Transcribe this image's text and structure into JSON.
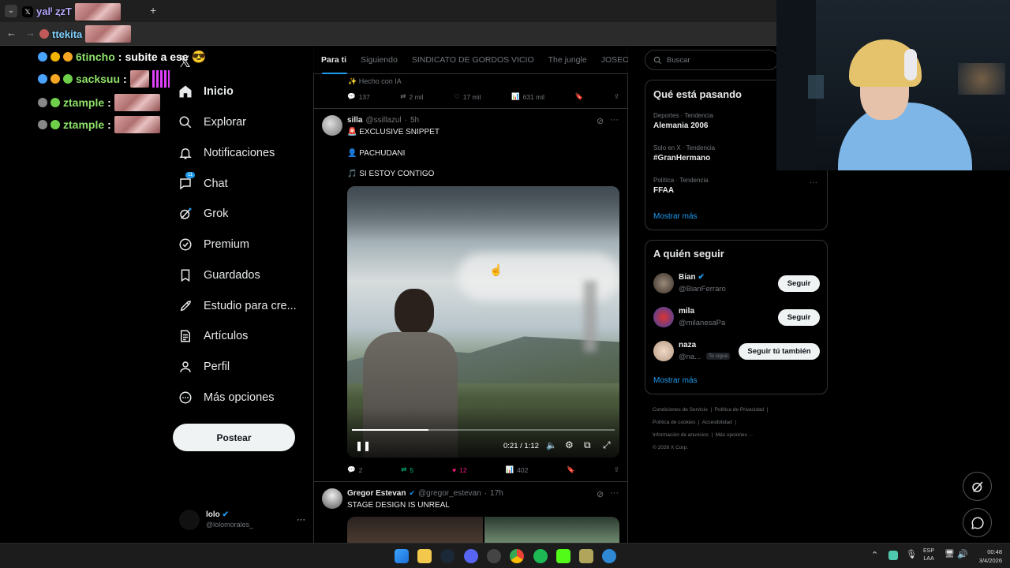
{
  "browser": {
    "tab_title": "ya yo",
    "address_text": "ttekita"
  },
  "chat_overlay": {
    "lines": [
      {
        "user": "6tincho",
        "message": "subite a ese"
      },
      {
        "user": "sacksuu",
        "message": ""
      },
      {
        "user": "ztample",
        "message": ""
      },
      {
        "user": "ztample",
        "message": ""
      }
    ],
    "top_users": [
      "yalⁱ ȥzT",
      "ttekita"
    ]
  },
  "sidebar": {
    "items": [
      {
        "label": "Inicio",
        "icon": "home-icon"
      },
      {
        "label": "Explorar",
        "icon": "search-icon"
      },
      {
        "label": "Notificaciones",
        "icon": "bell-icon"
      },
      {
        "label": "Chat",
        "icon": "chat-icon",
        "badge": "11"
      },
      {
        "label": "Grok",
        "icon": "grok-icon"
      },
      {
        "label": "Premium",
        "icon": "premium-icon"
      },
      {
        "label": "Guardados",
        "icon": "bookmark-icon"
      },
      {
        "label": "Estudio para cre...",
        "icon": "rocket-icon"
      },
      {
        "label": "Artículos",
        "icon": "article-icon"
      },
      {
        "label": "Perfil",
        "icon": "person-icon"
      },
      {
        "label": "Más opciones",
        "icon": "more-circle-icon"
      }
    ],
    "post_label": "Postear",
    "account": {
      "name": "lolo",
      "handle": "@lolomorales_"
    }
  },
  "tabs": [
    "Para ti",
    "Siguiendo",
    "SINDICATO DE GORDOS VICIO",
    "The jungle",
    "JOSEO"
  ],
  "feed": {
    "prev_tweet": {
      "ai_note": "Hecho con IA",
      "replies": "137",
      "reposts": "2 mil",
      "likes": "17 mil",
      "views": "631 mil"
    },
    "tweet1": {
      "name": "silla",
      "handle": "@ssillazul",
      "time": "5h",
      "line1": "🚨 EXCLUSIVE SNIPPET",
      "line2": "👤 PACHUDANI",
      "line3": "🎵 SI ESTOY CONTIGO",
      "video_time": "0:21 / 1:12",
      "video_progress": 0.29,
      "replies": "2",
      "reposts": "5",
      "likes": "12",
      "views": "402"
    },
    "tweet2": {
      "name": "Gregor Estevan",
      "handle": "@gregor_estevan",
      "time": "17h",
      "text": "STAGE DESIGN IS UNREAL"
    }
  },
  "right": {
    "search_placeholder": "Buscar",
    "trends_title": "Qué está pasando",
    "trends": [
      {
        "category": "Deportes · Tendencia",
        "name": "Alemania 2006"
      },
      {
        "category": "Solo en X · Tendencia",
        "name": "#GranHermano"
      },
      {
        "category": "Política · Tendencia",
        "name": "FFAA"
      }
    ],
    "show_more": "Mostrar más",
    "follow_title": "A quién seguir",
    "follow": [
      {
        "name": "Bian",
        "handle": "@BianFerraro",
        "button": "Seguir",
        "tag": ""
      },
      {
        "name": "mila",
        "handle": "@milanesaPa",
        "button": "Seguir",
        "tag": ""
      },
      {
        "name": "naza",
        "handle": "@na...",
        "button": "Seguir tú también",
        "tag": "Te sigue"
      }
    ],
    "footer": [
      "Condiciones de Servicio",
      "Política de Privacidad",
      "Política de cookies",
      "Accesibilidad",
      "Información de anuncios",
      "Más opciones ···",
      "© 2026 X Corp."
    ]
  },
  "taskbar": {
    "lang_top": "ESP",
    "lang_bottom": "LAA",
    "time": "00:48",
    "date": "3/4/2026"
  },
  "colors": {
    "accent": "#1d9bf0",
    "like": "#f91880",
    "repost": "#00ba7c",
    "bg": "#000000"
  }
}
